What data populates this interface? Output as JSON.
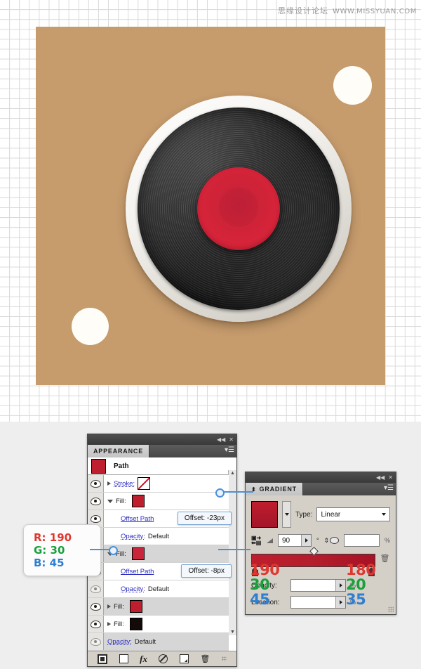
{
  "watermark": {
    "cn": "思缘设计论坛",
    "url": "WWW.MISSYUAN.COM"
  },
  "artwork": {
    "name": "vinyl-record-illustration",
    "background_color": "#c69c6d",
    "record_label_color": "#d2243a",
    "record_body_color": "#1c1c1c",
    "rim_color": "#f2f0ec",
    "dot_color": "#fffdf8"
  },
  "appearance_panel": {
    "tab_label": "APPEARANCE",
    "collapse_icon": "◀◀",
    "close_icon": "✕",
    "menu_icon": "panel-menu-icon",
    "item_title": "Path",
    "item_swatch_color": "#be1e2d",
    "rows": [
      {
        "label": "Stroke:",
        "value": "",
        "swatch": "none"
      },
      {
        "label": "Fill:",
        "value": "",
        "swatch": "#be1e2d"
      },
      {
        "label": "Offset Path",
        "value": "Offset: -23px",
        "swatch": ""
      },
      {
        "label": "Opacity:",
        "value": "Default",
        "swatch": ""
      },
      {
        "label": "Fill:",
        "value": "",
        "swatch": "#c8253a"
      },
      {
        "label": "Offset Path",
        "value": "Offset: -8px",
        "swatch": ""
      },
      {
        "label": "Opacity:",
        "value": "Default",
        "swatch": ""
      },
      {
        "label": "Fill:",
        "value": "",
        "swatch": "#be1e2d"
      },
      {
        "label": "Fill:",
        "value": "",
        "swatch": "#140a0a"
      },
      {
        "label": "Opacity:",
        "value": "Default",
        "swatch": ""
      }
    ],
    "footer_icons": [
      "add-new-stroke-icon",
      "add-new-fill-icon",
      "add-new-effect-icon",
      "clear-appearance-icon",
      "duplicate-item-icon",
      "delete-item-icon"
    ],
    "scroll_up_icon": "▲",
    "scroll_down_icon": "▼"
  },
  "gradient_panel": {
    "tab_label": "GRADIENT",
    "collapse_icon": "◀◀",
    "close_icon": "✕",
    "menu_icon": "panel-menu-icon",
    "swatch_color": "#be1e2d",
    "type_label": "Type:",
    "type_value": "Linear",
    "angle_value": "90",
    "degree_symbol": "°",
    "aspect_value": "",
    "percent_symbol": "%",
    "opacity_label": "Opacity:",
    "opacity_value": "",
    "location_label": "Location:",
    "location_value": "",
    "reverse_icon": "reverse-gradient-icon",
    "angle_icon": "angle-icon",
    "aspect_ratio_icon": "aspect-ratio-icon",
    "delete-stop-icon": "trash-icon",
    "gradient_start_color": "#be1e2d",
    "gradient_end_color": "#a61325",
    "stop_left": {
      "r": "190",
      "g": "30",
      "b": "45"
    },
    "stop_right": {
      "r": "180",
      "g": "20",
      "b": "35"
    }
  },
  "rgb_callout": {
    "r": "R: 190",
    "g": "G: 30",
    "b": "B: 45"
  }
}
